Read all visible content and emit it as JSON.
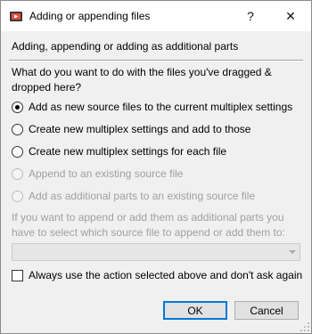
{
  "window": {
    "title": "Adding or appending files",
    "help_glyph": "?",
    "close_glyph": "✕"
  },
  "dialog": {
    "heading": "Adding, appending or adding as additional parts",
    "question": "What do you want to do with the files you've dragged & dropped here?",
    "options": [
      {
        "label": "Add as new source files to the current multiplex settings",
        "checked": true,
        "enabled": true
      },
      {
        "label": "Create new multiplex settings and add to those",
        "checked": false,
        "enabled": true
      },
      {
        "label": "Create new multiplex settings for each file",
        "checked": false,
        "enabled": true
      },
      {
        "label": "Append to an existing source file",
        "checked": false,
        "enabled": false
      },
      {
        "label": "Add as additional parts to an existing source file",
        "checked": false,
        "enabled": false
      }
    ],
    "note": "If you want to append or add them as additional parts you have to select which source file to append or add them to:",
    "source_select_value": "",
    "always_use_label": "Always use the action selected above and don't ask again",
    "always_use_checked": false
  },
  "buttons": {
    "ok": "OK",
    "cancel": "Cancel"
  },
  "colors": {
    "accent": "#0078d7",
    "disabled_text": "#a0a0a0",
    "dialog_bg": "#f0f0f0"
  }
}
